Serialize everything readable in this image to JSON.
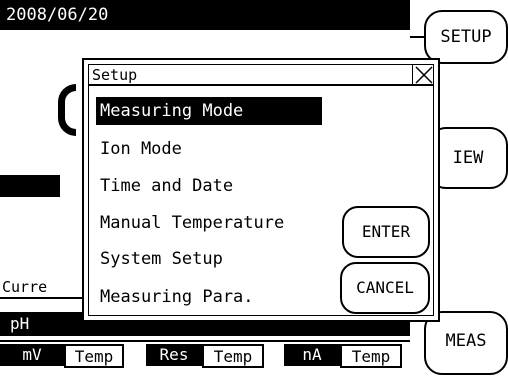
{
  "status_bar": {
    "date": "2008/06/20"
  },
  "side_buttons": {
    "setup": "SETUP",
    "view": "IEW",
    "meas": "MEAS"
  },
  "background": {
    "current_label": "Curre",
    "ph_label": "pH",
    "row_cells": [
      "mV",
      "Temp",
      "Res",
      "Temp",
      "nA",
      "Temp"
    ]
  },
  "dialog": {
    "title": "Setup",
    "menu_items": [
      "Measuring Mode",
      "Ion Mode",
      "Time and Date",
      "Manual Temperature",
      "System Setup",
      "Measuring Para."
    ],
    "selected_index": 0,
    "enter_label": "ENTER",
    "cancel_label": "CANCEL"
  }
}
